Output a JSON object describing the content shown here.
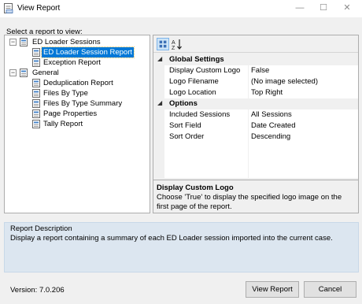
{
  "window": {
    "title": "View Report",
    "minimize": "—",
    "maximize": "☐",
    "close": "✕"
  },
  "tree": {
    "label": "Select a report to view:",
    "groups": [
      {
        "label": "ED Loader Sessions",
        "expander": "−",
        "items": [
          {
            "label": "ED Loader Session Report",
            "selected": true
          },
          {
            "label": "Exception Report"
          }
        ]
      },
      {
        "label": "General",
        "expander": "−",
        "items": [
          {
            "label": "Deduplication Report"
          },
          {
            "label": "Files By Type"
          },
          {
            "label": "Files By Type Summary"
          },
          {
            "label": "Page Properties"
          },
          {
            "label": "Tally Report"
          }
        ]
      }
    ]
  },
  "properties": {
    "toolbar": {
      "alpha_label": "AZ↓"
    },
    "categories": [
      {
        "name": "Global Settings",
        "toggle": "◢",
        "rows": [
          {
            "name": "Display Custom Logo",
            "value": "False"
          },
          {
            "name": "Logo Filename",
            "value": "(No image selected)"
          },
          {
            "name": "Logo Location",
            "value": "Top Right"
          }
        ]
      },
      {
        "name": "Options",
        "toggle": "◢",
        "rows": [
          {
            "name": "Included Sessions",
            "value": "All Sessions"
          },
          {
            "name": "Sort Field",
            "value": "Date Created"
          },
          {
            "name": "Sort Order",
            "value": "Descending"
          }
        ]
      }
    ],
    "help": {
      "title": "Display Custom Logo",
      "text": "Choose 'True' to display the specified logo image on the first page of the report."
    }
  },
  "description": {
    "label": "Report Description",
    "text": "Display a report containing a summary of each ED Loader session imported into the current case."
  },
  "version": "Version: 7.0.206",
  "buttons": {
    "view": "View Report",
    "cancel": "Cancel"
  },
  "colors": {
    "selection": "#0078d7",
    "description_bg": "#dce6f0"
  }
}
